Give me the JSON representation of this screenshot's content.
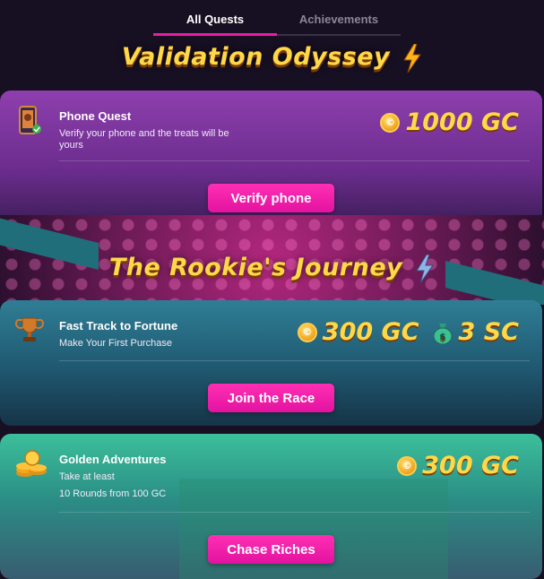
{
  "tabs": [
    {
      "label": "All Quests",
      "active": true
    },
    {
      "label": "Achievements",
      "active": false
    }
  ],
  "sections": [
    {
      "title": "Validation Odyssey"
    },
    {
      "title": "The Rookie's Journey"
    }
  ],
  "quests": [
    {
      "title": "Phone Quest",
      "description": "Verify your phone and the treats will be yours",
      "reward_gc": "1000 GC",
      "button": "Verify phone",
      "icon": "phone-icon"
    },
    {
      "title": "Fast Track to Fortune",
      "description": "Make Your First Purchase",
      "reward_gc": "300 GC",
      "reward_sc": "3 SC",
      "button": "Join the Race",
      "icon": "trophy-icon"
    },
    {
      "title": "Golden Adventures",
      "description_line1": "Take at least",
      "description_line2": "10 Rounds from 100 GC",
      "reward_gc": "300 GC",
      "button": "Chase Riches",
      "icon": "coin-stack-icon"
    }
  ],
  "colors": {
    "accent": "#ec1ba6",
    "reward_text": "#ffd84a",
    "background": "#170f22"
  }
}
